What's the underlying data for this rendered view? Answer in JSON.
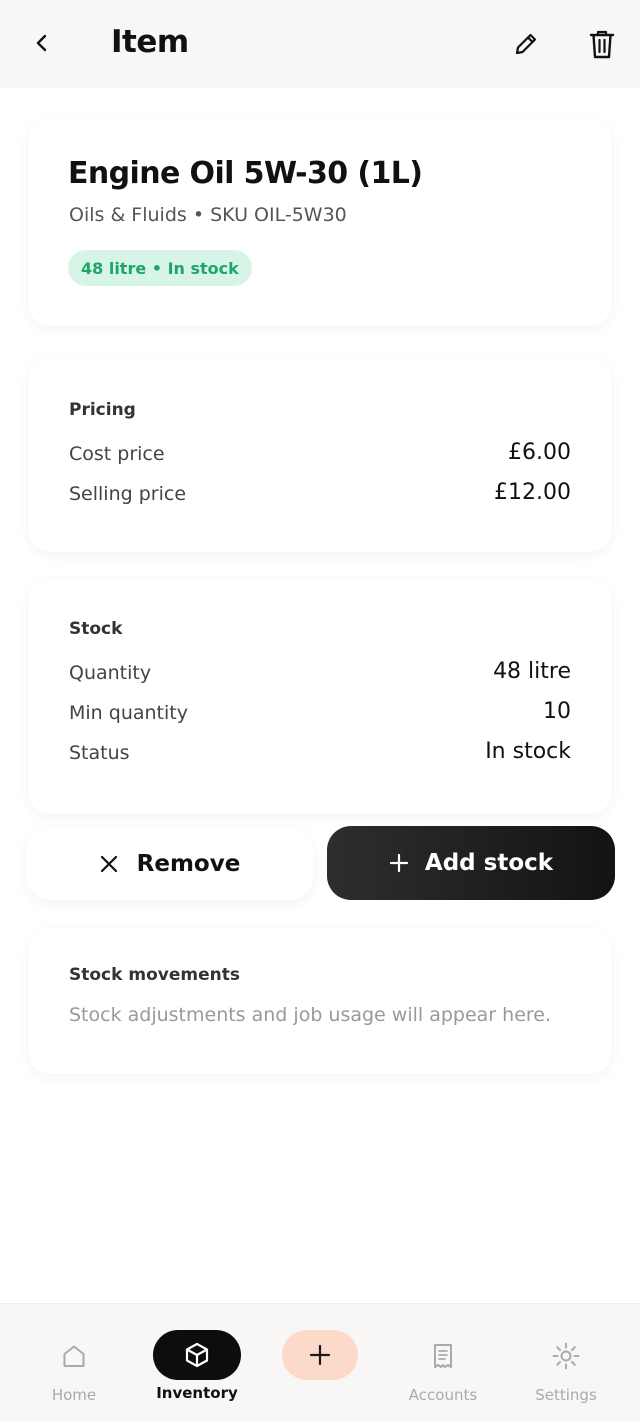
{
  "header": {
    "title": "Item",
    "back_icon": "chevron-left-icon",
    "edit_icon": "pencil-icon",
    "delete_icon": "trash-icon"
  },
  "item": {
    "name": "Engine Oil 5W-30 (1L)",
    "meta": "Oils & Fluids • SKU OIL-5W30",
    "badge": "48 litre • In stock",
    "badge_bg": "#d6f5e6",
    "badge_color": "#1ea56a"
  },
  "pricing": {
    "title": "Pricing",
    "rows": [
      {
        "label": "Cost price",
        "value": "£6.00"
      },
      {
        "label": "Selling price",
        "value": "£12.00"
      }
    ]
  },
  "stock": {
    "title": "Stock",
    "rows": [
      {
        "label": "Quantity",
        "value": "48 litre"
      },
      {
        "label": "Min quantity",
        "value": "10"
      },
      {
        "label": "Status",
        "value": "In stock"
      }
    ]
  },
  "actions": {
    "remove_label": "Remove",
    "remove_icon": "close-icon",
    "add_label": "Add stock",
    "add_icon": "plus-icon"
  },
  "movements": {
    "title": "Stock movements",
    "empty_text": "Stock adjustments and job usage will appear here."
  },
  "nav": {
    "home": "Home",
    "inventory": "Inventory",
    "accounts": "Accounts",
    "settings": "Settings",
    "active": "Inventory",
    "add_button_color": "#fcd9c9"
  }
}
